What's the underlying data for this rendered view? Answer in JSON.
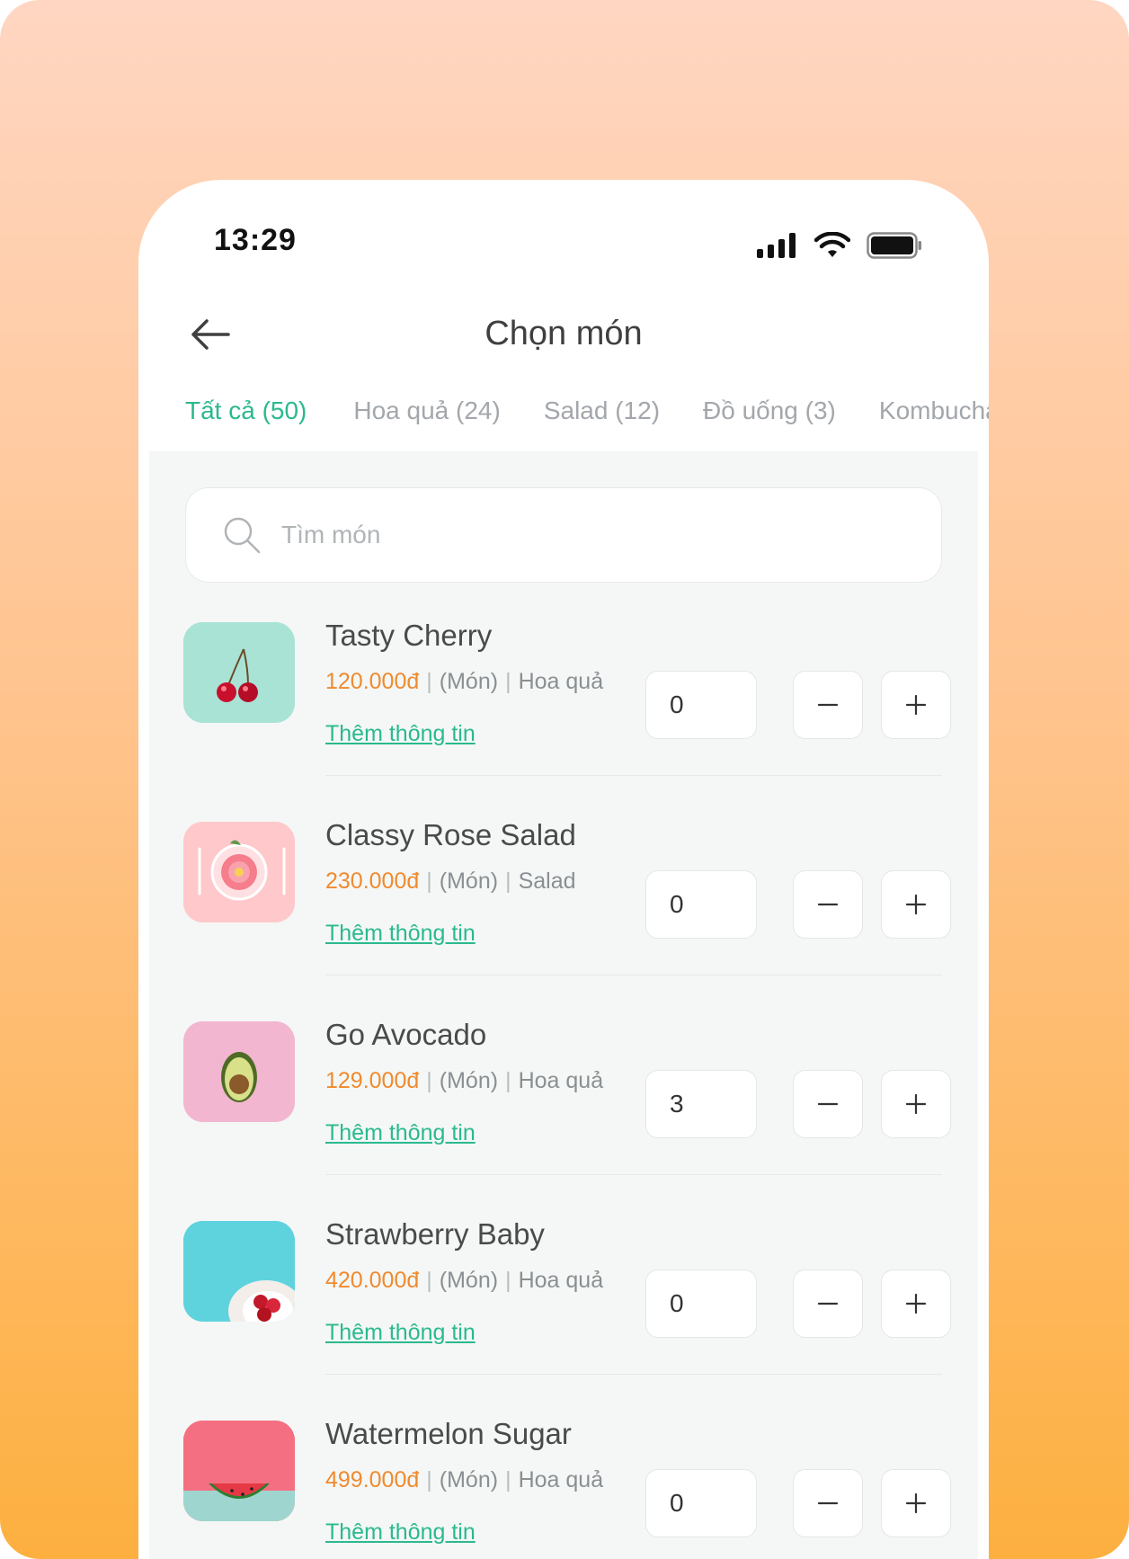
{
  "status_bar": {
    "time": "13:29"
  },
  "header": {
    "title": "Chọn món"
  },
  "tabs": [
    {
      "label": "Tất cả (50)",
      "active": true
    },
    {
      "label": "Hoa quả (24)"
    },
    {
      "label": "Salad (12)"
    },
    {
      "label": "Đồ uống (3)"
    },
    {
      "label": "Kombucha"
    }
  ],
  "search": {
    "placeholder": "Tìm món"
  },
  "items": [
    {
      "name": "Tasty Cherry",
      "price": "120.000đ",
      "unit": "(Món)",
      "category": "Hoa quả",
      "link": "Thêm thông tin",
      "qty": "0",
      "image": "cherry"
    },
    {
      "name": "Classy Rose Salad",
      "price": "230.000đ",
      "unit": "(Món)",
      "category": "Salad",
      "link": "Thêm thông tin",
      "qty": "0",
      "image": "rose-salad"
    },
    {
      "name": "Go Avocado",
      "price": "129.000đ",
      "unit": "(Món)",
      "category": "Hoa quả",
      "link": "Thêm thông tin",
      "qty": "3",
      "image": "avocado"
    },
    {
      "name": "Strawberry Baby",
      "price": "420.000đ",
      "unit": "(Món)",
      "category": "Hoa quả",
      "link": "Thêm thông tin",
      "qty": "0",
      "image": "strawberry"
    },
    {
      "name": "Watermelon Sugar",
      "price": "499.000đ",
      "unit": "(Món)",
      "category": "Hoa quả",
      "link": "Thêm thông tin",
      "qty": "0",
      "image": "watermelon"
    }
  ],
  "colors": {
    "accent": "#2BB98F",
    "price": "#F08A2E",
    "background_top": "#FFD6C2",
    "background_bottom": "#FDB040"
  }
}
